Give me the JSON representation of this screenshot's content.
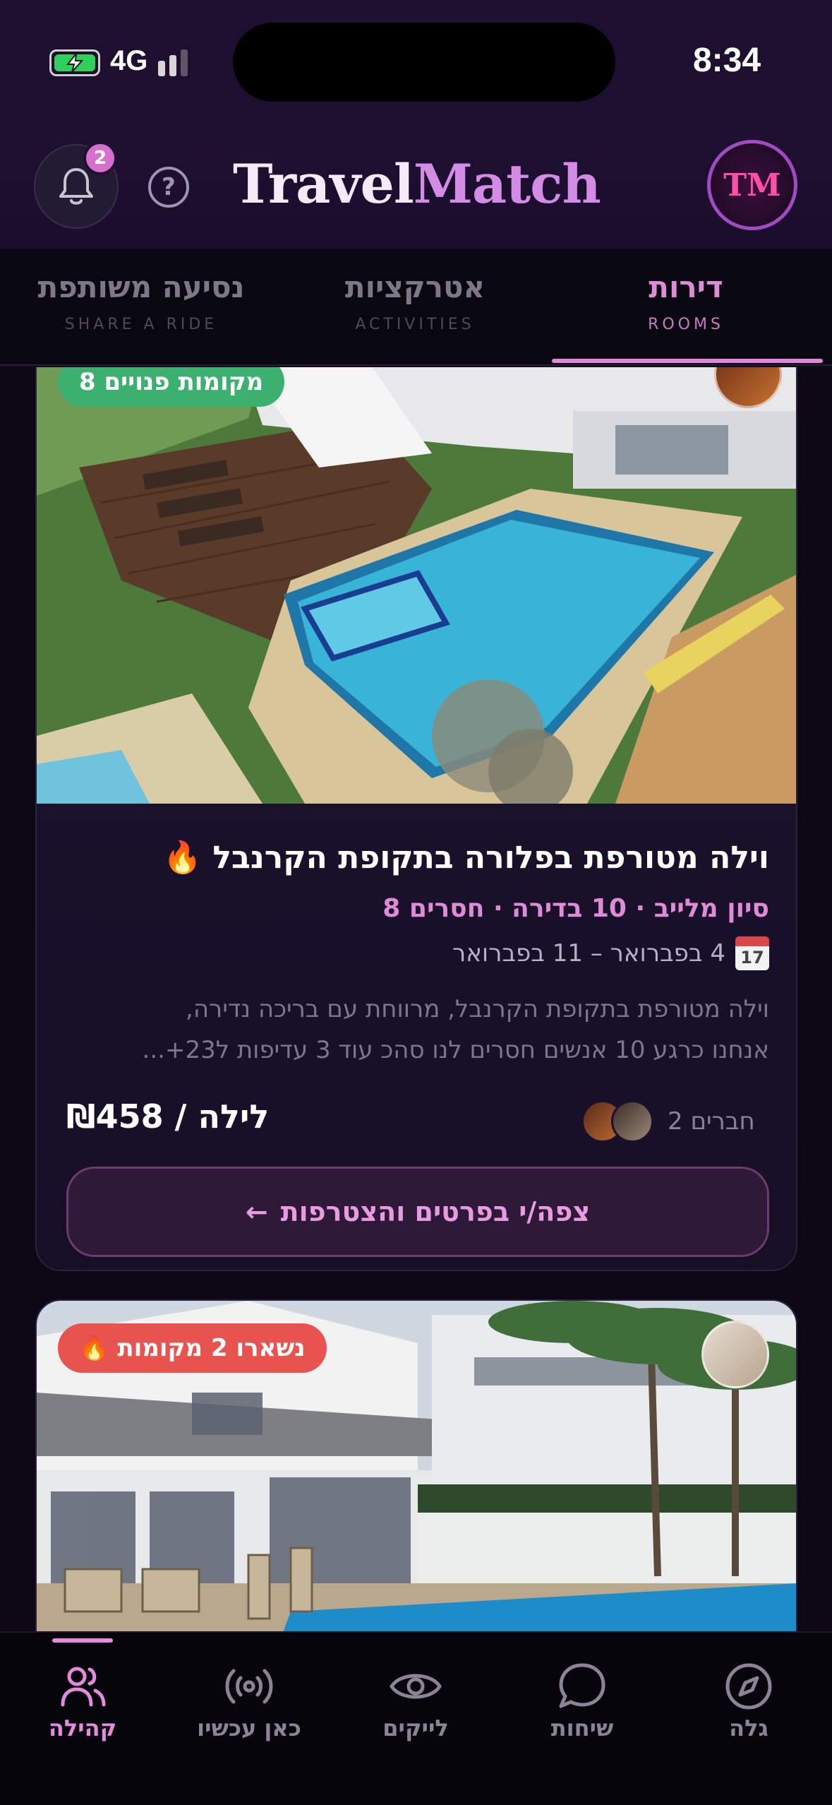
{
  "status": {
    "network": "4G",
    "time": "8:34"
  },
  "header": {
    "brand_part1": "Travel",
    "brand_part2": "Match",
    "notif_count": "2",
    "help_glyph": "?",
    "logo_text": "TM"
  },
  "tabs": [
    {
      "he": "דירות",
      "en": "ROOMS",
      "active": true
    },
    {
      "he": "אטרקציות",
      "en": "ACTIVITIES",
      "active": false
    },
    {
      "he": "נסיעה משותפת",
      "en": "SHARE A RIDE",
      "active": false
    }
  ],
  "listings": [
    {
      "spots_badge": "8 מקומות פנויים",
      "title": "וילה מטורפת בפלורה בתקופת הקרנבל 🔥",
      "meta": "סיון מלייב · 10 בדירה · חסרים 8",
      "calendar_day": "17",
      "dates": "4 בפברואר – 11 בפברואר",
      "description_line1": "וילה מטורפת בתקופת הקרנבל, מרווחת עם בריכה נדירה,",
      "description_line2": "אנחנו כרגע 10 אנשים חסרים לנו סהכ עוד 3 עדיפות ל23+...",
      "friends": "2 חברים",
      "price": "₪458 / לילה",
      "cta": "צפה/י בפרטים והצטרפות",
      "cta_arrow": "←"
    },
    {
      "spots_badge": "נשארו 2 מקומות",
      "badge_icon": "🔥"
    }
  ],
  "bottom_nav": [
    {
      "label": "גלה",
      "icon": "compass-icon",
      "active": false
    },
    {
      "label": "שיחות",
      "icon": "chat-bubble-icon",
      "active": false
    },
    {
      "label": "לייקים",
      "icon": "eye-icon",
      "active": false
    },
    {
      "label": "כאן עכשיו",
      "icon": "broadcast-icon",
      "active": false
    },
    {
      "label": "קהילה",
      "icon": "users-icon",
      "active": true
    }
  ],
  "colors": {
    "accent_pink": "#e18ad8",
    "spots_green": "#3bb06f",
    "spots_red": "#e8524f",
    "background": "#0f0a1c"
  }
}
